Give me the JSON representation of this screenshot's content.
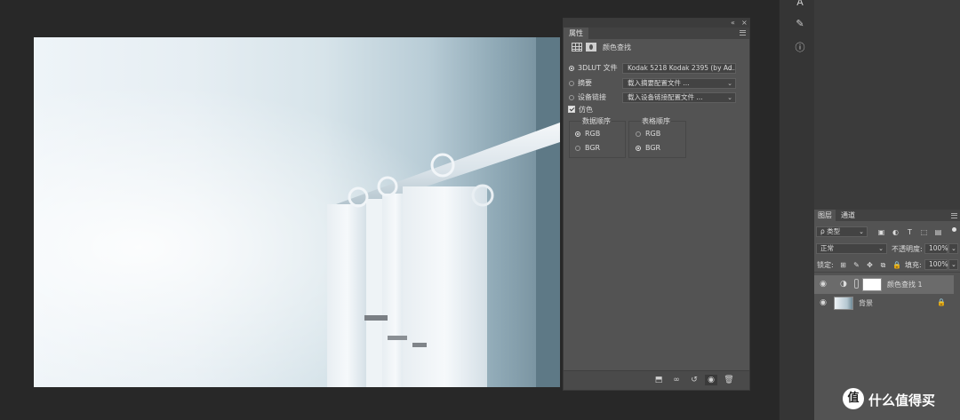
{
  "properties_panel": {
    "tab_label": "属性",
    "header_title": "颜色查找",
    "options": [
      {
        "label": "3DLUT 文件",
        "selected": true,
        "dropdown": "Kodak 5218 Kodak 2395 (by Ad..."
      },
      {
        "label": "摘要",
        "selected": false,
        "dropdown": "载入摘要配置文件 ..."
      },
      {
        "label": "设备链接",
        "selected": false,
        "dropdown": "载入设备链接配置文件 ..."
      }
    ],
    "dither_label": "仿色",
    "data_order": {
      "title": "数据顺序",
      "rgb": "RGB",
      "bgr": "BGR",
      "selected": "RGB"
    },
    "table_order": {
      "title": "表格顺序",
      "rgb": "RGB",
      "bgr": "BGR",
      "selected": "BGR"
    },
    "footer_icons": [
      "clip-to-layer-icon",
      "view-previous-icon",
      "reset-icon",
      "visibility-icon",
      "delete-icon"
    ]
  },
  "layers_panel": {
    "tabs": [
      "图层",
      "通道"
    ],
    "filter_select": "ρ 类型",
    "blend_mode": "正常",
    "opacity_label": "不透明度:",
    "opacity_value": "100%",
    "lock_label": "锁定:",
    "fill_label": "填充:",
    "fill_value": "100%",
    "layers": [
      {
        "name": "颜色查找 1",
        "type": "adjustment",
        "visible": true,
        "selected": true
      },
      {
        "name": "背景",
        "type": "pixel",
        "visible": true,
        "locked": true,
        "selected": false
      }
    ]
  },
  "watermark": {
    "symbol": "值",
    "text": "什么值得买"
  },
  "colors": {
    "panel": "#535353",
    "background": "#282828",
    "selected_layer": "#6b6b6b"
  }
}
